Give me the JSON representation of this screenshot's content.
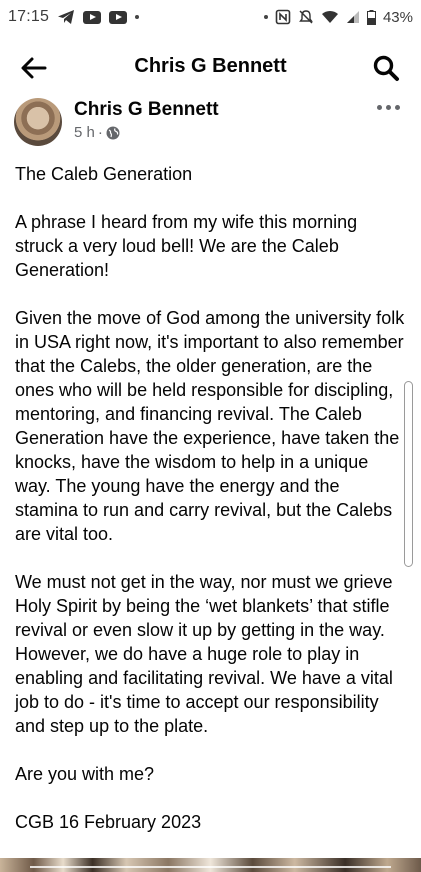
{
  "status_bar": {
    "time": "17:15",
    "battery": "43%",
    "icons": [
      "telegram-icon",
      "youtube-icon",
      "youtube-icon",
      "dot-icon",
      "dot-icon",
      "nfc-icon",
      "mute-icon",
      "wifi-icon",
      "signal-icon",
      "battery-icon"
    ]
  },
  "header": {
    "title": "Chris G Bennett",
    "back_icon": "back-arrow-icon",
    "search_icon": "search-icon"
  },
  "post": {
    "author": "Chris G Bennett",
    "time": "5 h",
    "separator": "·",
    "privacy_icon": "globe-icon",
    "more_icon": "more-options-icon",
    "paragraphs": [
      "The Caleb Generation",
      "A phrase I heard from my wife this morning struck a very loud bell! We are the Caleb Generation!",
      "Given the move of God among the university folk in USA right now, it's important to also remember that the Calebs, the older generation, are the ones who will be held responsible for discipling, mentoring, and financing revival. The Caleb Generation have the experience, have taken the knocks, have the wisdom to help in a unique way. The young have the energy and the stamina to run and carry revival, but the Calebs are vital too.",
      "We must not get in the way, nor must we grieve Holy Spirit by being the ‘wet blankets’ that stifle revival or even slow it up by getting in the way. However, we do have a huge role to play in enabling and facilitating revival. We have a vital job to do - it's time to accept our responsibility and step up to the plate.",
      "Are you with me?",
      "CGB 16 February 2023"
    ]
  },
  "colors": {
    "text": "#050505",
    "secondary_text": "#65676b",
    "background": "#ffffff"
  }
}
